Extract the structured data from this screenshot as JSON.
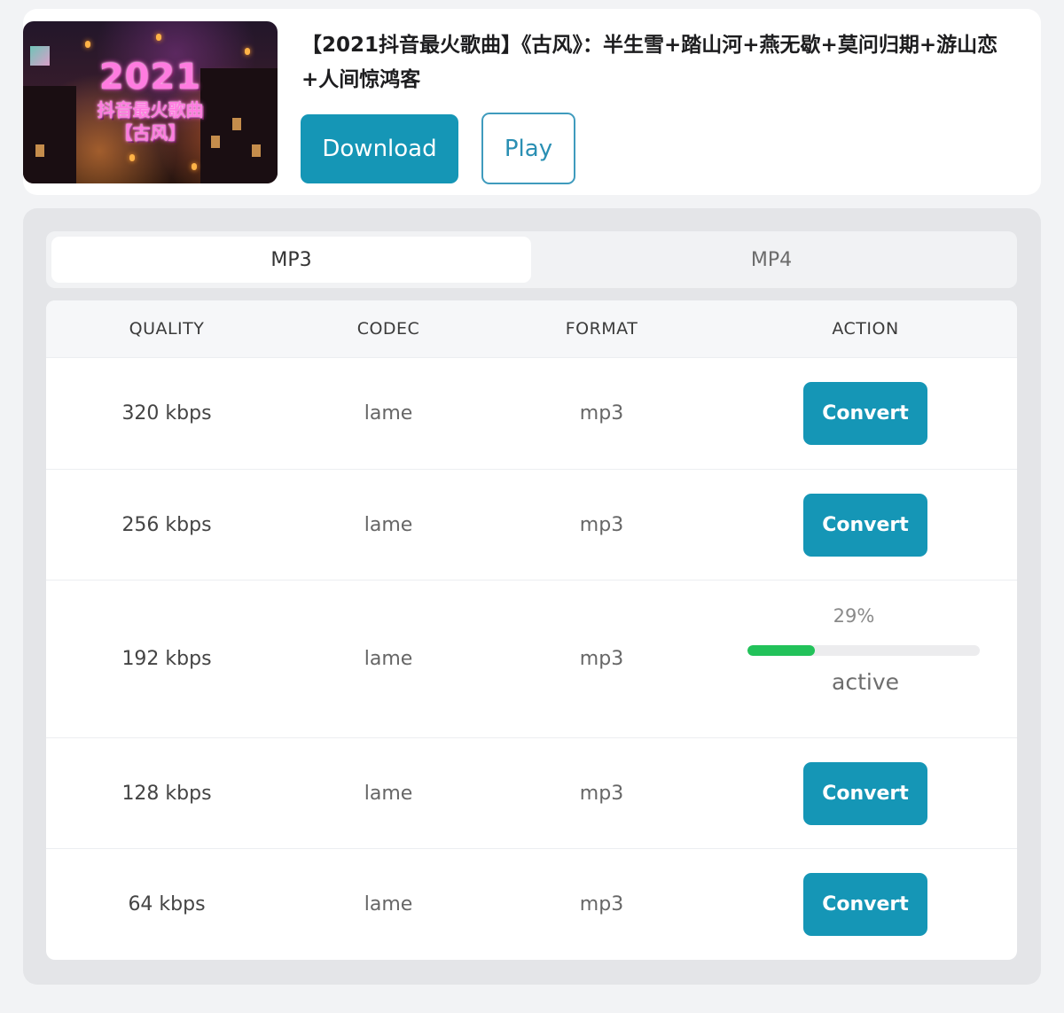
{
  "video": {
    "title": "【2021抖音最火歌曲】《古风》：半生雪+踏山河+燕无歇+莫问归期+游山恋+人间惊鸿客",
    "thumbnail": {
      "year": "2021",
      "line1": "抖音最火歌曲",
      "line2": "【古风】"
    },
    "download_label": "Download",
    "play_label": "Play"
  },
  "tabs": [
    {
      "label": "MP3",
      "active": true
    },
    {
      "label": "MP4",
      "active": false
    }
  ],
  "table": {
    "headers": [
      "QUALITY",
      "CODEC",
      "FORMAT",
      "ACTION"
    ],
    "rows": [
      {
        "quality": "320 kbps",
        "codec": "lame",
        "format": "mp3",
        "action": "Convert"
      },
      {
        "quality": "256 kbps",
        "codec": "lame",
        "format": "mp3",
        "action": "Convert"
      },
      {
        "quality": "192 kbps",
        "codec": "lame",
        "format": "mp3",
        "progress_text": "29%",
        "progress": 0.29,
        "status": "active"
      },
      {
        "quality": "128 kbps",
        "codec": "lame",
        "format": "mp3",
        "action": "Convert"
      },
      {
        "quality": "64 kbps",
        "codec": "lame",
        "format": "mp3",
        "action": "Convert"
      }
    ]
  },
  "colors": {
    "accent": "#1596b6",
    "progress": "#22c25a"
  }
}
